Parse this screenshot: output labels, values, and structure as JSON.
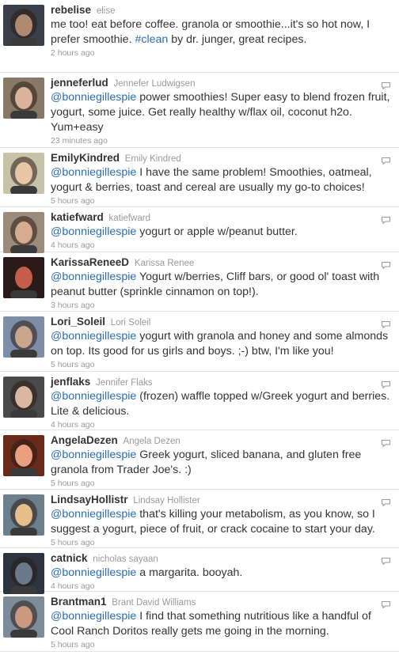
{
  "reply_icon": "reply-icon",
  "tweets": [
    {
      "screen_name": "rebelise",
      "full_name": "elise",
      "mention": "",
      "text": "me too! eat before coffee. granola or smoothie...it's so hot now, I prefer smoothie.",
      "hashtag": "#clean",
      "text_after": "by dr. junger, great recipes.",
      "time": "2 hours ago",
      "avatar_bg": "#3a3f4a",
      "avatar_fg": "#b08a70",
      "height": 92,
      "show_reply": false
    },
    {
      "screen_name": "jenneferlud",
      "full_name": "Jennefer Ludwigsen",
      "mention": "@bonniegillespie",
      "text": "power smoothies! Super easy to blend frozen fruit, yogurt, some juice. Get really healthy w/flax oil, coconut h2o. Yum+easy",
      "hashtag": "",
      "text_after": "",
      "time": "23 minutes ago",
      "avatar_bg": "#8a7866",
      "avatar_fg": "#d9b39a",
      "height": 95,
      "show_reply": true
    },
    {
      "screen_name": "EmilyKindred",
      "full_name": "Emily Kindred",
      "mention": "@bonniegillespie",
      "text": "I have the same problem! Smoothies, oatmeal, yogurt & berries, toast and cereal are usually my go-to choices!",
      "hashtag": "",
      "text_after": "",
      "time": "5 hours ago",
      "avatar_bg": "#c8c2a8",
      "avatar_fg": "#e8c7a6",
      "height": 75,
      "show_reply": true
    },
    {
      "screen_name": "katiefward",
      "full_name": "katiefward",
      "mention": "@bonniegillespie",
      "text": "yogurt or apple w/peanut butter.",
      "hashtag": "",
      "text_after": "",
      "time": "4 hours ago",
      "avatar_bg": "#9c8a7a",
      "avatar_fg": "#d6ab90",
      "height": 57,
      "show_reply": true
    },
    {
      "screen_name": "KarissaReneeD",
      "full_name": "Karissa Renee",
      "mention": "@bonniegillespie",
      "text": "Yogurt w/berries, Cliff bars, or good ol' toast with peanut butter (sprinkle cinnamon on top!).",
      "hashtag": "",
      "text_after": "",
      "time": "3 hours ago",
      "avatar_bg": "#2a1a1a",
      "avatar_fg": "#c45e4a",
      "height": 75,
      "show_reply": true
    },
    {
      "screen_name": "Lori_Soleil",
      "full_name": "Lori Soleil",
      "mention": "@bonniegillespie",
      "text": "yogurt with granola and honey and some almonds on top. Its good for us girls and boys. ;-) btw, I'm like you!",
      "hashtag": "",
      "text_after": "",
      "time": "5 hours ago",
      "avatar_bg": "#7d8ea6",
      "avatar_fg": "#c9a68a",
      "height": 76,
      "show_reply": true
    },
    {
      "screen_name": "jenflaks",
      "full_name": "Jennifer Flaks",
      "mention": "@bonniegillespie",
      "text": "(frozen) waffle topped w/Greek yogurt and berries. Lite & delicious.",
      "hashtag": "",
      "text_after": "",
      "time": "4 hours ago",
      "avatar_bg": "#4a4a4a",
      "avatar_fg": "#d9b7a0",
      "height": 74,
      "show_reply": true
    },
    {
      "screen_name": "AngelaDezen",
      "full_name": "Angela Dezen",
      "mention": "@bonniegillespie",
      "text": "Greek yogurt, sliced banana, and gluten free granola from Trader Joe's. :)",
      "hashtag": "",
      "text_after": "",
      "time": "5 hours ago",
      "avatar_bg": "#6a2a1a",
      "avatar_fg": "#e8a080",
      "height": 75,
      "show_reply": true
    },
    {
      "screen_name": "LindsayHollistr",
      "full_name": "Lindsay Hollister",
      "mention": "@bonniegillespie",
      "text": "that's killing your metabolism, as you know, so I suggest a yogurt, piece of fruit, or crack cocaine to start your day.",
      "hashtag": "",
      "text_after": "",
      "time": "5 hours ago",
      "avatar_bg": "#6c7f8c",
      "avatar_fg": "#e6c08a",
      "height": 74,
      "show_reply": true
    },
    {
      "screen_name": "catnick",
      "full_name": "nicholas sayaan",
      "mention": "@bonniegillespie",
      "text": "a margarita. booyah.",
      "hashtag": "",
      "text_after": "",
      "time": "4 hours ago",
      "avatar_bg": "#2c3440",
      "avatar_fg": "#6a7a8a",
      "height": 55,
      "show_reply": true
    },
    {
      "screen_name": "Brantman1",
      "full_name": "Brant David Williams",
      "mention": "@bonniegillespie",
      "text": "I find that something nutritious like a handful of Cool Ranch Doritos really gets me going in the morning.",
      "hashtag": "",
      "text_after": "",
      "time": "5 hours ago",
      "avatar_bg": "#7d8c9a",
      "avatar_fg": "#c99a80",
      "height": 76,
      "show_reply": true
    }
  ]
}
